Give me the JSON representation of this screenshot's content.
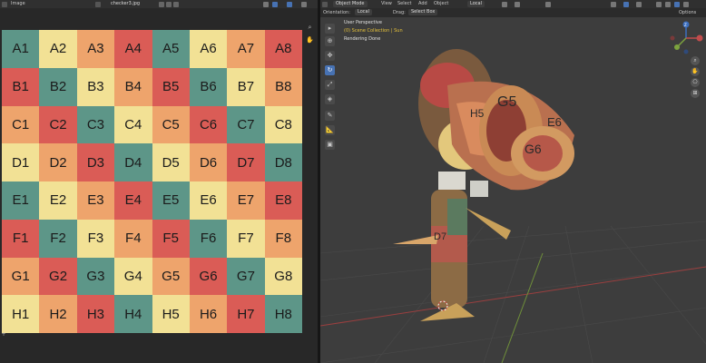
{
  "image_editor": {
    "menu_image": "Image",
    "filename": "checker3.jpg",
    "grid_rows": [
      {
        "row": "A",
        "cells": [
          "A1",
          "A2",
          "A3",
          "A4",
          "A5",
          "A6",
          "A7",
          "A8"
        ],
        "colors": [
          "#5d9688",
          "#f2e195",
          "#eea46c",
          "#da5c56",
          "#5d9688",
          "#f2e195",
          "#eea46c",
          "#da5c56"
        ]
      },
      {
        "row": "B",
        "cells": [
          "B1",
          "B2",
          "B3",
          "B4",
          "B5",
          "B6",
          "B7",
          "B8"
        ],
        "colors": [
          "#da5c56",
          "#5d9688",
          "#f2e195",
          "#eea46c",
          "#da5c56",
          "#5d9688",
          "#f2e195",
          "#eea46c"
        ]
      },
      {
        "row": "C",
        "cells": [
          "C1",
          "C2",
          "C3",
          "C4",
          "C5",
          "C6",
          "C7",
          "C8"
        ],
        "colors": [
          "#eea46c",
          "#da5c56",
          "#5d9688",
          "#f2e195",
          "#eea46c",
          "#da5c56",
          "#5d9688",
          "#f2e195"
        ]
      },
      {
        "row": "D",
        "cells": [
          "D1",
          "D2",
          "D3",
          "D4",
          "D5",
          "D6",
          "D7",
          "D8"
        ],
        "colors": [
          "#f2e195",
          "#eea46c",
          "#da5c56",
          "#5d9688",
          "#f2e195",
          "#eea46c",
          "#da5c56",
          "#5d9688"
        ]
      },
      {
        "row": "E",
        "cells": [
          "E1",
          "E2",
          "E3",
          "E4",
          "E5",
          "E6",
          "E7",
          "E8"
        ],
        "colors": [
          "#5d9688",
          "#f2e195",
          "#eea46c",
          "#da5c56",
          "#5d9688",
          "#f2e195",
          "#eea46c",
          "#da5c56"
        ]
      },
      {
        "row": "F",
        "cells": [
          "F1",
          "F2",
          "F3",
          "F4",
          "F5",
          "F6",
          "F7",
          "F8"
        ],
        "colors": [
          "#da5c56",
          "#5d9688",
          "#f2e195",
          "#eea46c",
          "#da5c56",
          "#5d9688",
          "#f2e195",
          "#eea46c"
        ]
      },
      {
        "row": "G",
        "cells": [
          "G1",
          "G2",
          "G3",
          "G4",
          "G5",
          "G6",
          "G7",
          "G8"
        ],
        "colors": [
          "#eea46c",
          "#da5c56",
          "#5d9688",
          "#f2e195",
          "#eea46c",
          "#da5c56",
          "#5d9688",
          "#f2e195"
        ]
      },
      {
        "row": "H",
        "cells": [
          "H1",
          "H2",
          "H3",
          "H4",
          "H5",
          "H6",
          "H7",
          "H8"
        ],
        "colors": [
          "#f2e195",
          "#eea46c",
          "#da5c56",
          "#5d9688",
          "#f2e195",
          "#eea46c",
          "#da5c56",
          "#5d9688"
        ]
      }
    ]
  },
  "viewport": {
    "mode": "Object Mode",
    "menus": [
      "View",
      "Select",
      "Add",
      "Object"
    ],
    "transform_space": "Local",
    "orientation_label": "Orientation:",
    "orientation_value": "Local",
    "drag_label": "Drag:",
    "drag_value": "Select Box",
    "options_label": "Options",
    "overlay_line1": "User Perspective",
    "overlay_line2": "(0) Scene Collection | Sun",
    "overlay_line3": "Rendering Done",
    "gizmo_axes": [
      "Z",
      "Y",
      "X"
    ],
    "colors": {
      "accent": "#4772b3",
      "overlay_highlight": "#e8c33a",
      "x_axis": "#c24c4c",
      "y_axis": "#7ca33e",
      "z_axis": "#3c6fbf"
    },
    "model_labels": [
      "G5",
      "G6",
      "E6",
      "H5",
      "D7"
    ]
  }
}
